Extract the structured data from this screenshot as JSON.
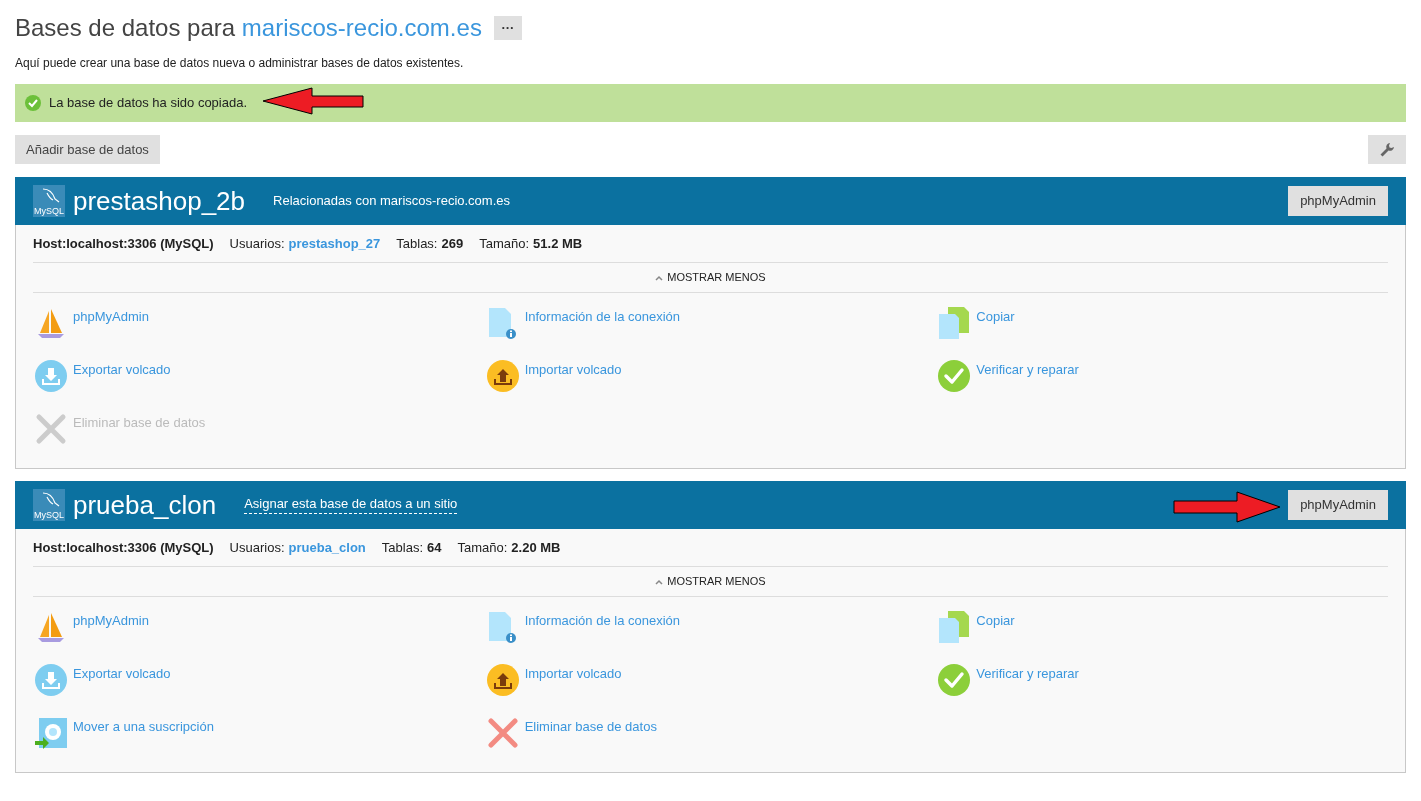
{
  "header": {
    "title": "Bases de datos para",
    "domain": "mariscos-recio.com.es",
    "more_button": "···"
  },
  "description": "Aquí puede crear una base de datos nueva o administrar bases de datos existentes.",
  "message": {
    "kind": "success",
    "text": "La base de datos ha sido copiada."
  },
  "toolbar": {
    "add_button": "Añadir base de datos"
  },
  "databases": [
    {
      "name": "prestashop_2b",
      "logo_text": "MySQL",
      "subtitle": {
        "kind": "related",
        "text": "Relacionadas con mariscos-recio.com.es"
      },
      "pma_button": "phpMyAdmin",
      "host": "Host:localhost:3306 (MySQL)",
      "users_label": "Usuarios:",
      "users_value": "prestashop_27",
      "tables_label": "Tablas:",
      "tables_value": "269",
      "size_label": "Tamaño:",
      "size_value": "51.2 MB",
      "toggle": "MOSTRAR MENOS",
      "expanded": true,
      "actions": [
        {
          "kind": "phpmyadmin",
          "label": "phpMyAdmin",
          "disabled": false
        },
        {
          "kind": "info",
          "label": "Información de la conexión",
          "disabled": false
        },
        {
          "kind": "copy",
          "label": "Copiar",
          "disabled": false
        },
        {
          "kind": "export",
          "label": "Exportar volcado",
          "disabled": false
        },
        {
          "kind": "import",
          "label": "Importar volcado",
          "disabled": false
        },
        {
          "kind": "check",
          "label": "Verificar y reparar",
          "disabled": false
        },
        {
          "kind": "delete",
          "label": "Eliminar base de datos",
          "disabled": true
        }
      ]
    },
    {
      "name": "prueba_clon",
      "logo_text": "MySQL",
      "subtitle": {
        "kind": "assign",
        "text": "Asignar esta base de datos a un sitio"
      },
      "pma_button": "phpMyAdmin",
      "host": "Host:localhost:3306 (MySQL)",
      "users_label": "Usuarios:",
      "users_value": "prueba_clon",
      "tables_label": "Tablas:",
      "tables_value": "64",
      "size_label": "Tamaño:",
      "size_value": "2.20 MB",
      "toggle": "MOSTRAR MENOS",
      "expanded": true,
      "actions": [
        {
          "kind": "phpmyadmin",
          "label": "phpMyAdmin",
          "disabled": false
        },
        {
          "kind": "info",
          "label": "Información de la conexión",
          "disabled": false
        },
        {
          "kind": "copy",
          "label": "Copiar",
          "disabled": false
        },
        {
          "kind": "export",
          "label": "Exportar volcado",
          "disabled": false
        },
        {
          "kind": "import",
          "label": "Importar volcado",
          "disabled": false
        },
        {
          "kind": "check",
          "label": "Verificar y reparar",
          "disabled": false
        },
        {
          "kind": "move",
          "label": "Mover a una suscripción",
          "disabled": false
        },
        {
          "kind": "delete",
          "label": "Eliminar base de datos",
          "disabled": false
        }
      ]
    }
  ]
}
